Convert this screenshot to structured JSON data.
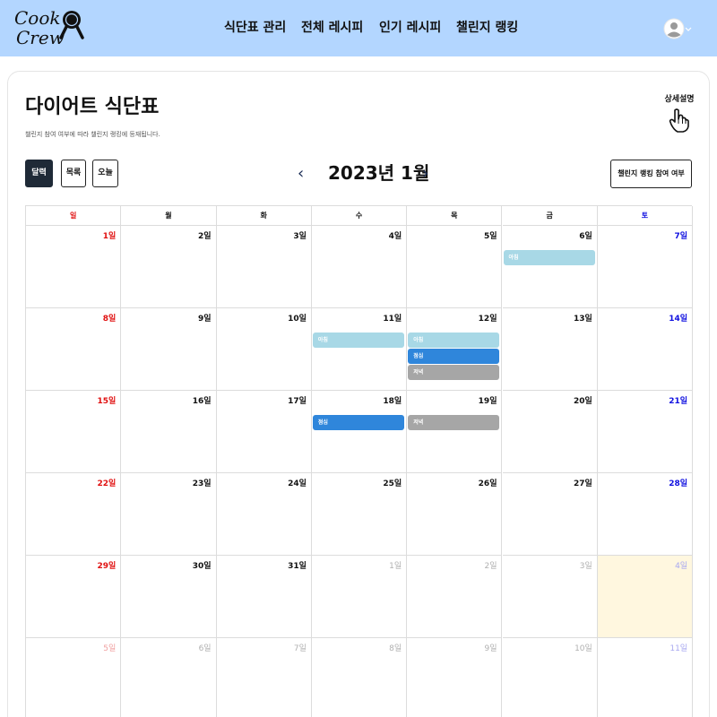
{
  "nav": {
    "logo_line1": "Cook",
    "logo_line2": "Crew",
    "items": [
      "식단표 관리",
      "전체 레시피",
      "인기 레시피",
      "챌린지 랭킹"
    ],
    "avatar_icon": "user-circle-icon"
  },
  "header": {
    "title": "다이어트 식단표",
    "subtitle": "챌린지 참여 여부에 따라 챌린지 랭킹에 등재됩니다.",
    "detail_label": "상세설명",
    "detail_icon": "hand-pointer-icon"
  },
  "toolbar": {
    "view_buttons": [
      "달력",
      "목록",
      "오늘"
    ],
    "active_view": "달력",
    "prev_arrow": "‹",
    "month_label": "2023년 1월",
    "next_arrow": "›",
    "challenge_button": "챌린지 랭킹 참여 여부"
  },
  "calendar": {
    "weekdays": [
      "일",
      "월",
      "화",
      "수",
      "목",
      "금",
      "토"
    ],
    "weeks": [
      [
        "1일",
        "2일",
        "3일",
        "4일",
        "5일",
        "6일",
        "7일"
      ],
      [
        "8일",
        "9일",
        "10일",
        "11일",
        "12일",
        "13일",
        "14일"
      ],
      [
        "15일",
        "16일",
        "17일",
        "18일",
        "19일",
        "20일",
        "21일"
      ],
      [
        "22일",
        "23일",
        "24일",
        "25일",
        "26일",
        "27일",
        "28일"
      ],
      [
        "29일",
        "30일",
        "31일",
        "1일",
        "2일",
        "3일",
        "4일"
      ],
      [
        "5일",
        "6일",
        "7일",
        "8일",
        "9일",
        "10일",
        "11일"
      ]
    ],
    "today": "2023-02-04",
    "events": [
      {
        "date": "6일",
        "label": "아침",
        "type": "breakfast"
      },
      {
        "date": "11일",
        "label": "아침",
        "type": "breakfast"
      },
      {
        "date": "12일",
        "label": "아침",
        "type": "breakfast"
      },
      {
        "date": "12일",
        "label": "점심",
        "type": "lunch"
      },
      {
        "date": "12일",
        "label": "저녁",
        "type": "dinner"
      },
      {
        "date": "18일",
        "label": "점심",
        "type": "lunch"
      },
      {
        "date": "19일",
        "label": "저녁",
        "type": "dinner"
      }
    ],
    "colors": {
      "breakfast": "#a8d8e6",
      "lunch": "#2f86db",
      "dinner": "#a6a6a6",
      "sunday": "#e01010",
      "saturday": "#1010e0",
      "today_bg": "#fff7df"
    }
  },
  "theme": {
    "nav_bg": "#b3d6ff",
    "active_button_bg": "#1f2a37"
  }
}
